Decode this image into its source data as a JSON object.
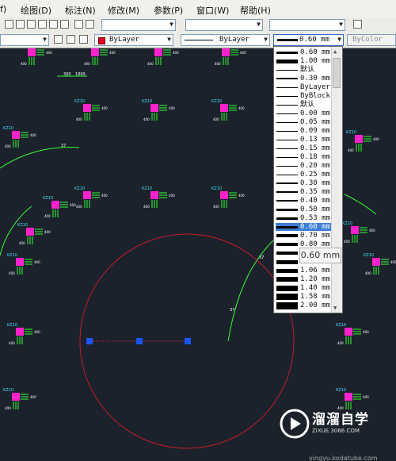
{
  "menu": {
    "items": [
      "f)",
      "绘图(D)",
      "标注(N)",
      "修改(M)",
      "参数(P)",
      "窗口(W)",
      "帮助(H)"
    ]
  },
  "properties_toolbar": {
    "color_value": "ByLayer",
    "linetype_value": "ByLayer",
    "lineweight_value": "0.60 mm",
    "plotstyle_value": "ByColor"
  },
  "lineweight_dropdown": {
    "items": [
      {
        "label": "0.60 mm",
        "weight": 3
      },
      {
        "label": "1.00 mm",
        "weight": 5
      },
      {
        "label": "默认",
        "weight": 1
      },
      {
        "label": "0.30 mm",
        "weight": 2
      },
      {
        "label": "ByLayer",
        "weight": 1
      },
      {
        "label": "ByBlock",
        "weight": 1
      },
      {
        "label": "默认",
        "weight": 1
      },
      {
        "label": "0.00 mm",
        "weight": 1
      },
      {
        "label": "0.05 mm",
        "weight": 1
      },
      {
        "label": "0.09 mm",
        "weight": 1
      },
      {
        "label": "0.13 mm",
        "weight": 1
      },
      {
        "label": "0.15 mm",
        "weight": 1
      },
      {
        "label": "0.18 mm",
        "weight": 1
      },
      {
        "label": "0.20 mm",
        "weight": 1
      },
      {
        "label": "0.25 mm",
        "weight": 1
      },
      {
        "label": "0.30 mm",
        "weight": 2
      },
      {
        "label": "0.35 mm",
        "weight": 2
      },
      {
        "label": "0.40 mm",
        "weight": 2
      },
      {
        "label": "0.50 mm",
        "weight": 3
      },
      {
        "label": "0.53 mm",
        "weight": 3
      },
      {
        "label": "0.60 mm",
        "weight": 3,
        "selected": true
      },
      {
        "label": "0.70 mm",
        "weight": 4
      },
      {
        "label": "0.80 mm",
        "weight": 4
      },
      {
        "label": "0.90 mm",
        "weight": 4
      },
      {
        "label": "1.00 mm",
        "weight": 5
      },
      {
        "label": "1.06 mm",
        "weight": 5
      },
      {
        "label": "1.20 mm",
        "weight": 6
      },
      {
        "label": "1.40 mm",
        "weight": 7
      },
      {
        "label": "1.58 mm",
        "weight": 8
      },
      {
        "label": "2.00 mm",
        "weight": 9
      }
    ]
  },
  "tooltip": "0.60 mm",
  "drawing": {
    "column_label": "KZ10",
    "dim_400": "400",
    "dim_300": "300",
    "dim_1800": "1800",
    "dim_37": "37"
  },
  "watermark": {
    "title": "溜溜自学",
    "url": "ZIXUE.3066.COM"
  },
  "colors": {
    "background": "#1b222c",
    "magenta": "#ff22cc",
    "green": "#33ff33",
    "cyan": "#44ddff",
    "red_circle": "#c41b28",
    "grip_blue": "#1a55ff",
    "selected_row": "#3b7fd8"
  }
}
